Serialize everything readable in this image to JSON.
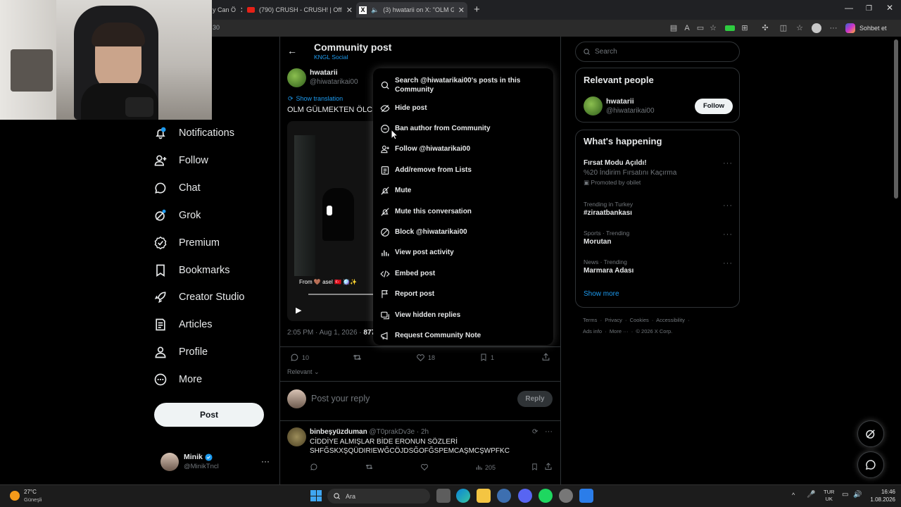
{
  "browser": {
    "tabs": [
      {
        "title": "y Can Ö"
      },
      {
        "title": "(790) CRUSH - CRUSH! | Official M"
      },
      {
        "title": "(3) hwatarii on X: \"OLM GÜLM"
      }
    ],
    "address_fragment": "30",
    "chat_button": "Sohbet et"
  },
  "nav": {
    "items": [
      {
        "label": "Notifications",
        "icon": "bell-icon"
      },
      {
        "label": "Follow",
        "icon": "person-plus-icon"
      },
      {
        "label": "Chat",
        "icon": "chat-bubble-icon"
      },
      {
        "label": "Grok",
        "icon": "grok-icon"
      },
      {
        "label": "Premium",
        "icon": "verified-badge-icon"
      },
      {
        "label": "Bookmarks",
        "icon": "bookmark-icon"
      },
      {
        "label": "Creator Studio",
        "icon": "rocket-icon"
      },
      {
        "label": "Articles",
        "icon": "article-icon"
      },
      {
        "label": "Profile",
        "icon": "person-icon"
      },
      {
        "label": "More",
        "icon": "more-circle-icon"
      }
    ],
    "post_label": "Post",
    "account": {
      "name": "Minik",
      "handle": "@MinikTncl"
    }
  },
  "header": {
    "title": "Community post",
    "community": "KNGL Social"
  },
  "post": {
    "author_name": "hwatarii",
    "author_handle": "@hiwatarikai00",
    "show_translation": "Show translation",
    "text": "OLM GÜLMEKTEN ÖLC",
    "video_overlay": "From 🤎 asel 🇹🇷 🪩✨",
    "timestamp": "2:05 PM · Aug 1, 2026 · ",
    "views_partial": "877",
    "stats": {
      "replies": "10",
      "likes": "18",
      "bookmarks": "1"
    },
    "sort_label": "Relevant"
  },
  "reply_box": {
    "placeholder": "Post your reply",
    "button": "Reply"
  },
  "reply": {
    "name": "binbeşyüzduman",
    "handle": "@T0prakDv3e",
    "time": "· 2h",
    "line1": "CİDDİYE ALMIŞLAR BİDE ERONUN SÖZLERİ",
    "line2": "SHFĞSKXŞQÜDIRIEWĞCÖJDSĞOFĞSPEMCAŞMCŞWPFKC",
    "views": "205"
  },
  "menu": {
    "items": [
      {
        "label": "Search @hiwatarikai00's posts in this Community",
        "icon": "search-magnifier-icon"
      },
      {
        "label": "Hide post",
        "icon": "eye-off-icon"
      },
      {
        "label": "Ban author from Community",
        "icon": "ban-circle-icon"
      },
      {
        "label": "Follow @hiwatarikai00",
        "icon": "person-plus-icon"
      },
      {
        "label": "Add/remove from Lists",
        "icon": "list-icon"
      },
      {
        "label": "Mute",
        "icon": "mute-icon"
      },
      {
        "label": "Mute this conversation",
        "icon": "mute-icon"
      },
      {
        "label": "Block @hiwatarikai00",
        "icon": "block-icon"
      },
      {
        "label": "View post activity",
        "icon": "bar-chart-icon"
      },
      {
        "label": "Embed post",
        "icon": "code-icon"
      },
      {
        "label": "Report post",
        "icon": "flag-icon"
      },
      {
        "label": "View hidden replies",
        "icon": "hidden-replies-icon"
      },
      {
        "label": "Request Community Note",
        "icon": "community-note-icon"
      }
    ]
  },
  "sidebar": {
    "search_placeholder": "Search",
    "relevant_title": "Relevant people",
    "person": {
      "name": "hwatarii",
      "handle": "@hiwatarikai00",
      "follow": "Follow"
    },
    "happening_title": "What's happening",
    "promo": {
      "title": "Fırsat Modu Açıldı!",
      "desc": "%20 İndirim Fırsatını Kaçırma",
      "promoted": "Promoted by obilet"
    },
    "trends": [
      {
        "context": "Trending in Turkey",
        "title": "#ziraatbankası"
      },
      {
        "context": "Sports · Trending",
        "title": "Morutan"
      },
      {
        "context": "News · Trending",
        "title": "Marmara Adası"
      }
    ],
    "show_more": "Show more",
    "footer1": "Terms  ·  Privacy  ·  Cookies  ·  Accessibility  ·",
    "footer2": "Ads info  ·  More ···  ·  © 2026 X Corp."
  },
  "taskbar": {
    "weather_temp": "27°C",
    "weather_desc": "Güneşli",
    "search_label": "Ara",
    "lang1": "TUR",
    "lang2": "UK",
    "time": "16:46",
    "date": "1.08.2026"
  },
  "colors": {
    "accent": "#1d9bf0",
    "background": "#000000",
    "border": "#2f3336",
    "muted": "#71767b"
  }
}
